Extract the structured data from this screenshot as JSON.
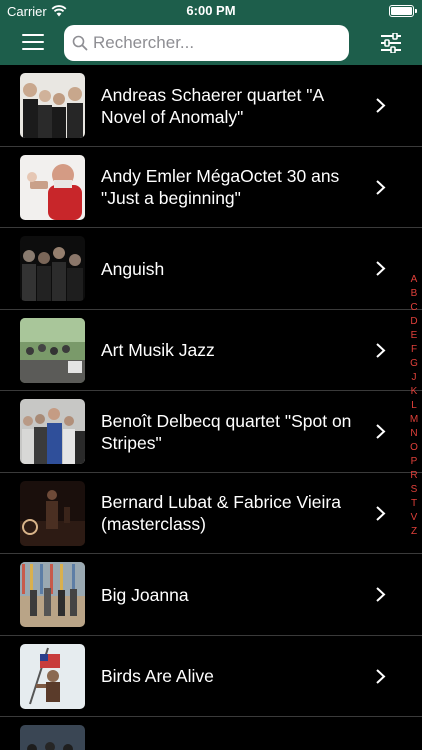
{
  "status_bar": {
    "carrier": "Carrier",
    "time": "6:00 PM"
  },
  "nav": {
    "search_placeholder": "Rechercher...",
    "menu_icon": "hamburger-menu-icon",
    "filter_icon": "sliders-icon"
  },
  "colors": {
    "nav_bg": "#1d5e4b",
    "list_bg": "#000000",
    "index_letters": "#e0403a",
    "separator": "#3a3a3a"
  },
  "list": {
    "items": [
      {
        "title": "Andreas Schaerer quartet \"A Novel of Anomaly\""
      },
      {
        "title": "Andy Emler MégaOctet 30 ans \"Just a beginning\""
      },
      {
        "title": "Anguish"
      },
      {
        "title": "Art Musik Jazz"
      },
      {
        "title": "Benoît Delbecq quartet \"Spot on Stripes\""
      },
      {
        "title": "Bernard Lubat & Fabrice Vieira (masterclass)"
      },
      {
        "title": "Big Joanna"
      },
      {
        "title": "Birds Are Alive"
      }
    ]
  },
  "section_index": [
    "A",
    "B",
    "C",
    "D",
    "E",
    "F",
    "G",
    "J",
    "K",
    "L",
    "M",
    "N",
    "O",
    "P",
    "R",
    "S",
    "T",
    "V",
    "Z"
  ]
}
